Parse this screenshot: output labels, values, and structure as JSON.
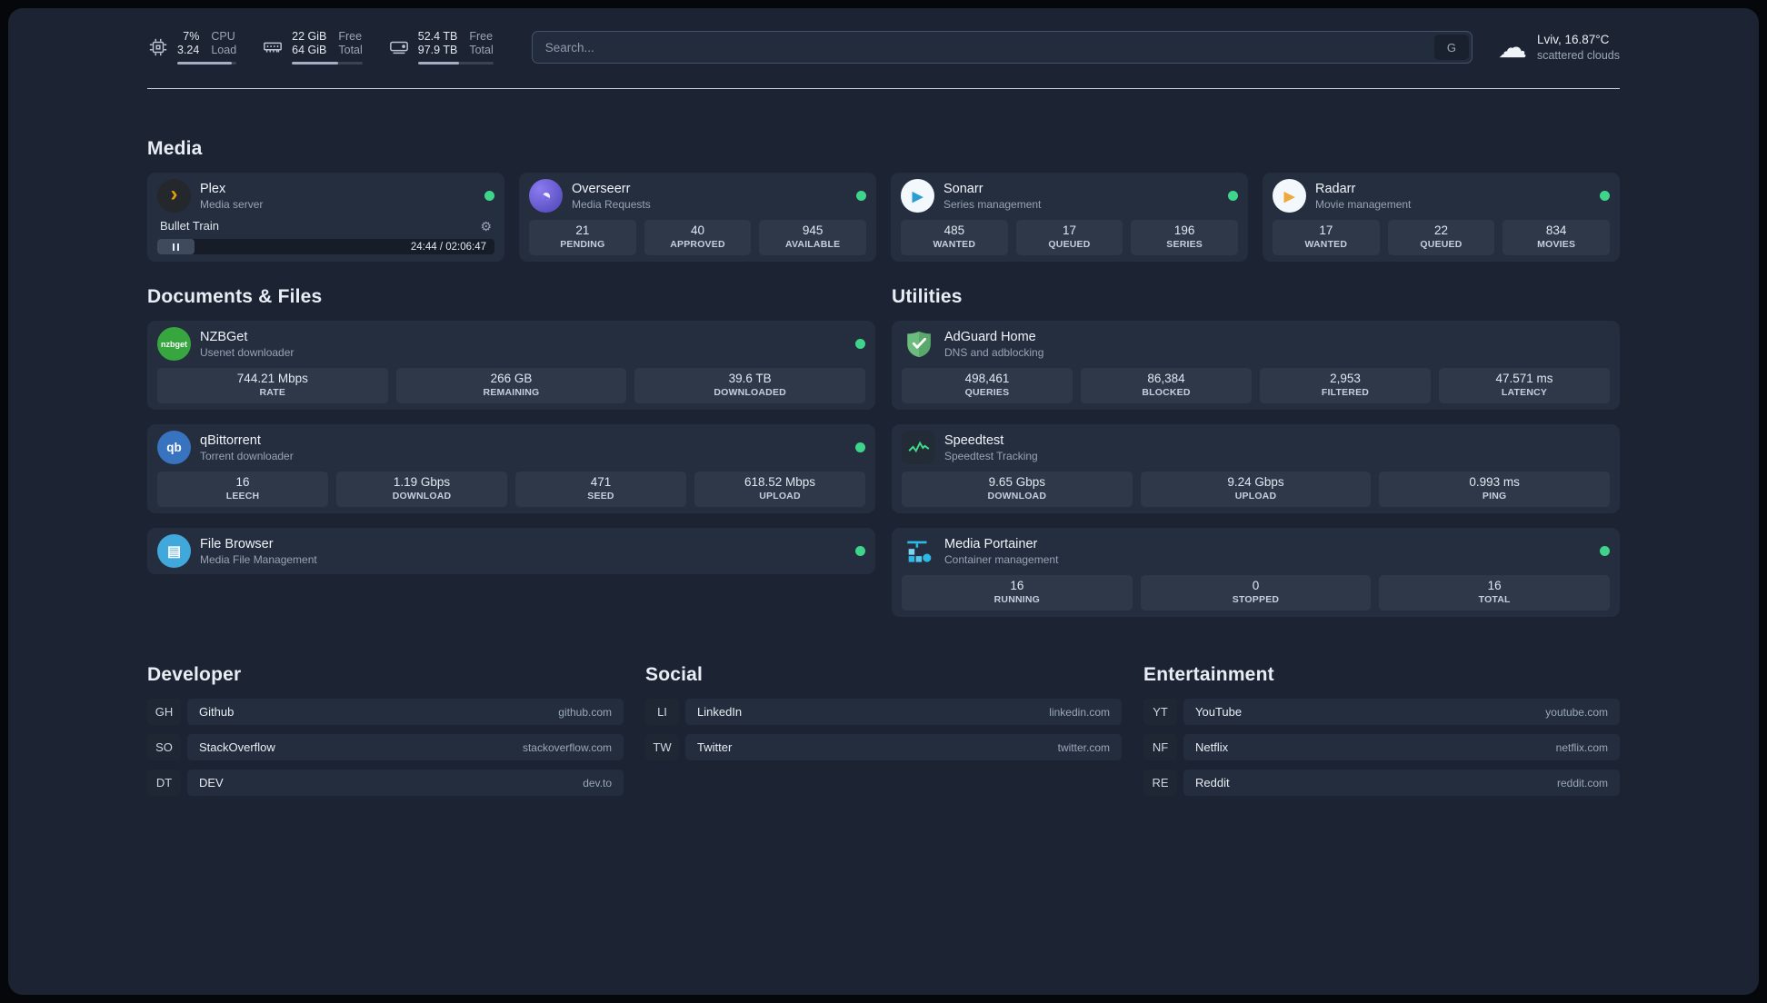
{
  "icons": {
    "plex": "›",
    "overseerr": "◐",
    "sonarr": "▶",
    "radarr": "▶",
    "nzbget": "nzbget",
    "qbittorrent": "qb",
    "filebrowser": "▤",
    "gear": "⚙",
    "cloud": "☁"
  },
  "topbar": {
    "resources": [
      {
        "name": "cpu",
        "value1": "7%",
        "value2": "3.24",
        "label1": "CPU",
        "label2": "Load",
        "progress": 92
      },
      {
        "name": "memory",
        "value1": "22 GiB",
        "value2": "64 GiB",
        "label1": "Free",
        "label2": "Total",
        "progress": 66
      },
      {
        "name": "disk",
        "value1": "52.4 TB",
        "value2": "97.9 TB",
        "label1": "Free",
        "label2": "Total",
        "progress": 54
      }
    ],
    "search": {
      "placeholder": "Search...",
      "button": "G"
    },
    "weather": {
      "location": "Lviv, 16.87°C",
      "condition": "scattered clouds"
    }
  },
  "sections": {
    "media": {
      "title": "Media",
      "services": [
        {
          "name": "Plex",
          "description": "Media server",
          "player": {
            "title": "Bullet Train",
            "time": "24:44 / 02:06:47",
            "progress": 11
          }
        },
        {
          "name": "Overseerr",
          "description": "Media Requests",
          "stats": [
            {
              "value": "21",
              "label": "PENDING"
            },
            {
              "value": "40",
              "label": "APPROVED"
            },
            {
              "value": "945",
              "label": "AVAILABLE"
            }
          ]
        },
        {
          "name": "Sonarr",
          "description": "Series management",
          "stats": [
            {
              "value": "485",
              "label": "WANTED"
            },
            {
              "value": "17",
              "label": "QUEUED"
            },
            {
              "value": "196",
              "label": "SERIES"
            }
          ]
        },
        {
          "name": "Radarr",
          "description": "Movie management",
          "stats": [
            {
              "value": "17",
              "label": "WANTED"
            },
            {
              "value": "22",
              "label": "QUEUED"
            },
            {
              "value": "834",
              "label": "MOVIES"
            }
          ]
        }
      ]
    },
    "documents": {
      "title": "Documents & Files",
      "services": [
        {
          "name": "NZBGet",
          "description": "Usenet downloader",
          "stats": [
            {
              "value": "744.21 Mbps",
              "label": "RATE"
            },
            {
              "value": "266 GB",
              "label": "REMAINING"
            },
            {
              "value": "39.6 TB",
              "label": "DOWNLOADED"
            }
          ]
        },
        {
          "name": "qBittorrent",
          "description": "Torrent downloader",
          "stats": [
            {
              "value": "16",
              "label": "LEECH"
            },
            {
              "value": "1.19 Gbps",
              "label": "DOWNLOAD"
            },
            {
              "value": "471",
              "label": "SEED"
            },
            {
              "value": "618.52 Mbps",
              "label": "UPLOAD"
            }
          ]
        },
        {
          "name": "File Browser",
          "description": "Media File Management"
        }
      ]
    },
    "utilities": {
      "title": "Utilities",
      "services": [
        {
          "name": "AdGuard Home",
          "description": "DNS and adblocking",
          "stats": [
            {
              "value": "498,461",
              "label": "QUERIES"
            },
            {
              "value": "86,384",
              "label": "BLOCKED"
            },
            {
              "value": "2,953",
              "label": "FILTERED"
            },
            {
              "value": "47.571 ms",
              "label": "LATENCY"
            }
          ]
        },
        {
          "name": "Speedtest",
          "description": "Speedtest Tracking",
          "stats": [
            {
              "value": "9.65 Gbps",
              "label": "DOWNLOAD"
            },
            {
              "value": "9.24 Gbps",
              "label": "UPLOAD"
            },
            {
              "value": "0.993 ms",
              "label": "PING"
            }
          ]
        },
        {
          "name": "Media Portainer",
          "description": "Container management",
          "stats": [
            {
              "value": "16",
              "label": "RUNNING"
            },
            {
              "value": "0",
              "label": "STOPPED"
            },
            {
              "value": "16",
              "label": "TOTAL"
            }
          ]
        }
      ]
    }
  },
  "bookmark_groups": [
    {
      "title": "Developer",
      "items": [
        {
          "abbr": "GH",
          "name": "Github",
          "url": "github.com"
        },
        {
          "abbr": "SO",
          "name": "StackOverflow",
          "url": "stackoverflow.com"
        },
        {
          "abbr": "DT",
          "name": "DEV",
          "url": "dev.to"
        }
      ]
    },
    {
      "title": "Social",
      "items": [
        {
          "abbr": "LI",
          "name": "LinkedIn",
          "url": "linkedin.com"
        },
        {
          "abbr": "TW",
          "name": "Twitter",
          "url": "twitter.com"
        }
      ]
    },
    {
      "title": "Entertainment",
      "items": [
        {
          "abbr": "YT",
          "name": "YouTube",
          "url": "youtube.com"
        },
        {
          "abbr": "NF",
          "name": "Netflix",
          "url": "netflix.com"
        },
        {
          "abbr": "RE",
          "name": "Reddit",
          "url": "reddit.com"
        }
      ]
    }
  ]
}
